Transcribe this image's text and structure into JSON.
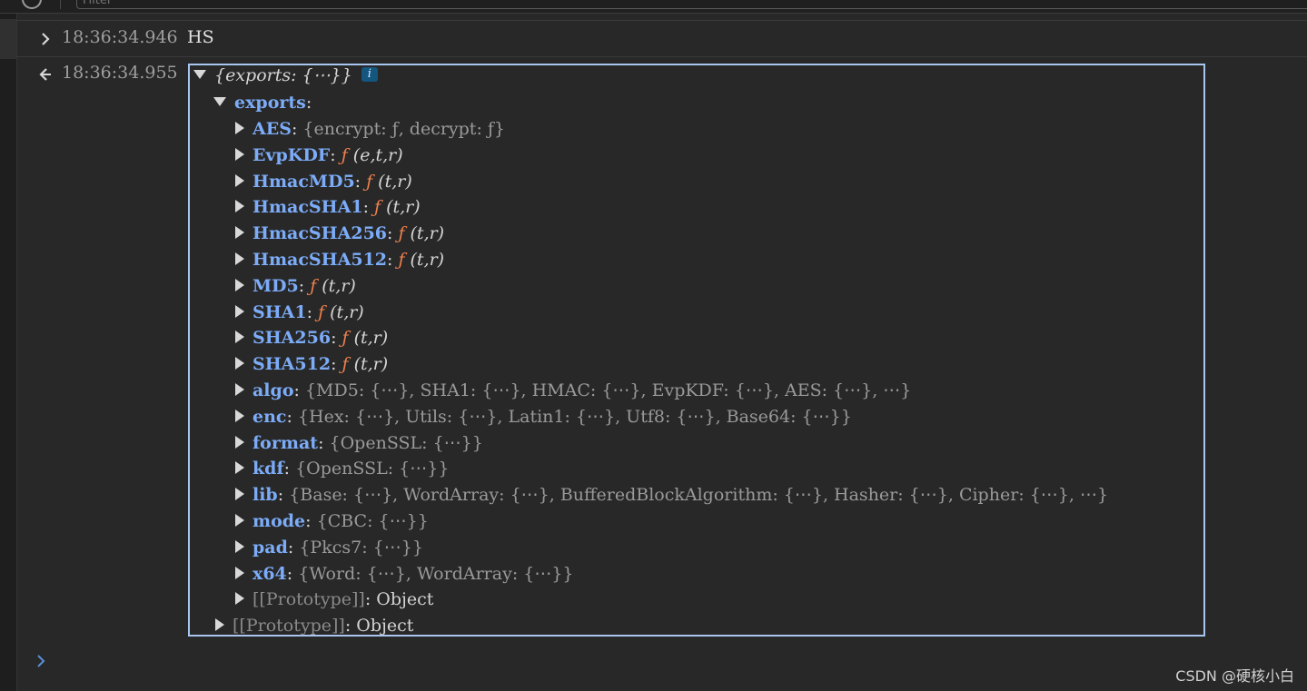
{
  "toolbar": {
    "filter_placeholder": "Filter"
  },
  "log": {
    "time": "18:36:34.946",
    "message": "HS"
  },
  "result": {
    "time": "18:36:34.955",
    "summary": "{exports: {⋯}}",
    "info_badge": "i",
    "exports_key": "exports",
    "items": [
      {
        "key": "AES",
        "value": "{encrypt: ƒ, decrypt: ƒ}"
      },
      {
        "key": "EvpKDF",
        "fn": "ƒ",
        "args": "(e,t,r)"
      },
      {
        "key": "HmacMD5",
        "fn": "ƒ",
        "args": "(t,r)"
      },
      {
        "key": "HmacSHA1",
        "fn": "ƒ",
        "args": "(t,r)"
      },
      {
        "key": "HmacSHA256",
        "fn": "ƒ",
        "args": "(t,r)"
      },
      {
        "key": "HmacSHA512",
        "fn": "ƒ",
        "args": "(t,r)"
      },
      {
        "key": "MD5",
        "fn": "ƒ",
        "args": "(t,r)"
      },
      {
        "key": "SHA1",
        "fn": "ƒ",
        "args": "(t,r)"
      },
      {
        "key": "SHA256",
        "fn": "ƒ",
        "args": "(t,r)"
      },
      {
        "key": "SHA512",
        "fn": "ƒ",
        "args": "(t,r)"
      },
      {
        "key": "algo",
        "value": "{MD5: {⋯}, SHA1: {⋯}, HMAC: {⋯}, EvpKDF: {⋯}, AES: {⋯},  ⋯}"
      },
      {
        "key": "enc",
        "value": "{Hex: {⋯}, Utils: {⋯}, Latin1: {⋯}, Utf8: {⋯}, Base64: {⋯}}"
      },
      {
        "key": "format",
        "value": "{OpenSSL: {⋯}}"
      },
      {
        "key": "kdf",
        "value": "{OpenSSL: {⋯}}"
      },
      {
        "key": "lib",
        "value": "{Base: {⋯}, WordArray: {⋯}, BufferedBlockAlgorithm: {⋯}, Hasher: {⋯}, Cipher: {⋯},  ⋯}"
      },
      {
        "key": "mode",
        "value": "{CBC: {⋯}}"
      },
      {
        "key": "pad",
        "value": "{Pkcs7: {⋯}}"
      },
      {
        "key": "x64",
        "value": "{Word: {⋯}, WordArray: {⋯}}"
      }
    ],
    "inner_prototype_key": "[[Prototype]]",
    "inner_prototype_value": "Object",
    "outer_prototype_key": "[[Prototype]]",
    "outer_prototype_value": "Object"
  },
  "watermark": "CSDN @硬核小白"
}
